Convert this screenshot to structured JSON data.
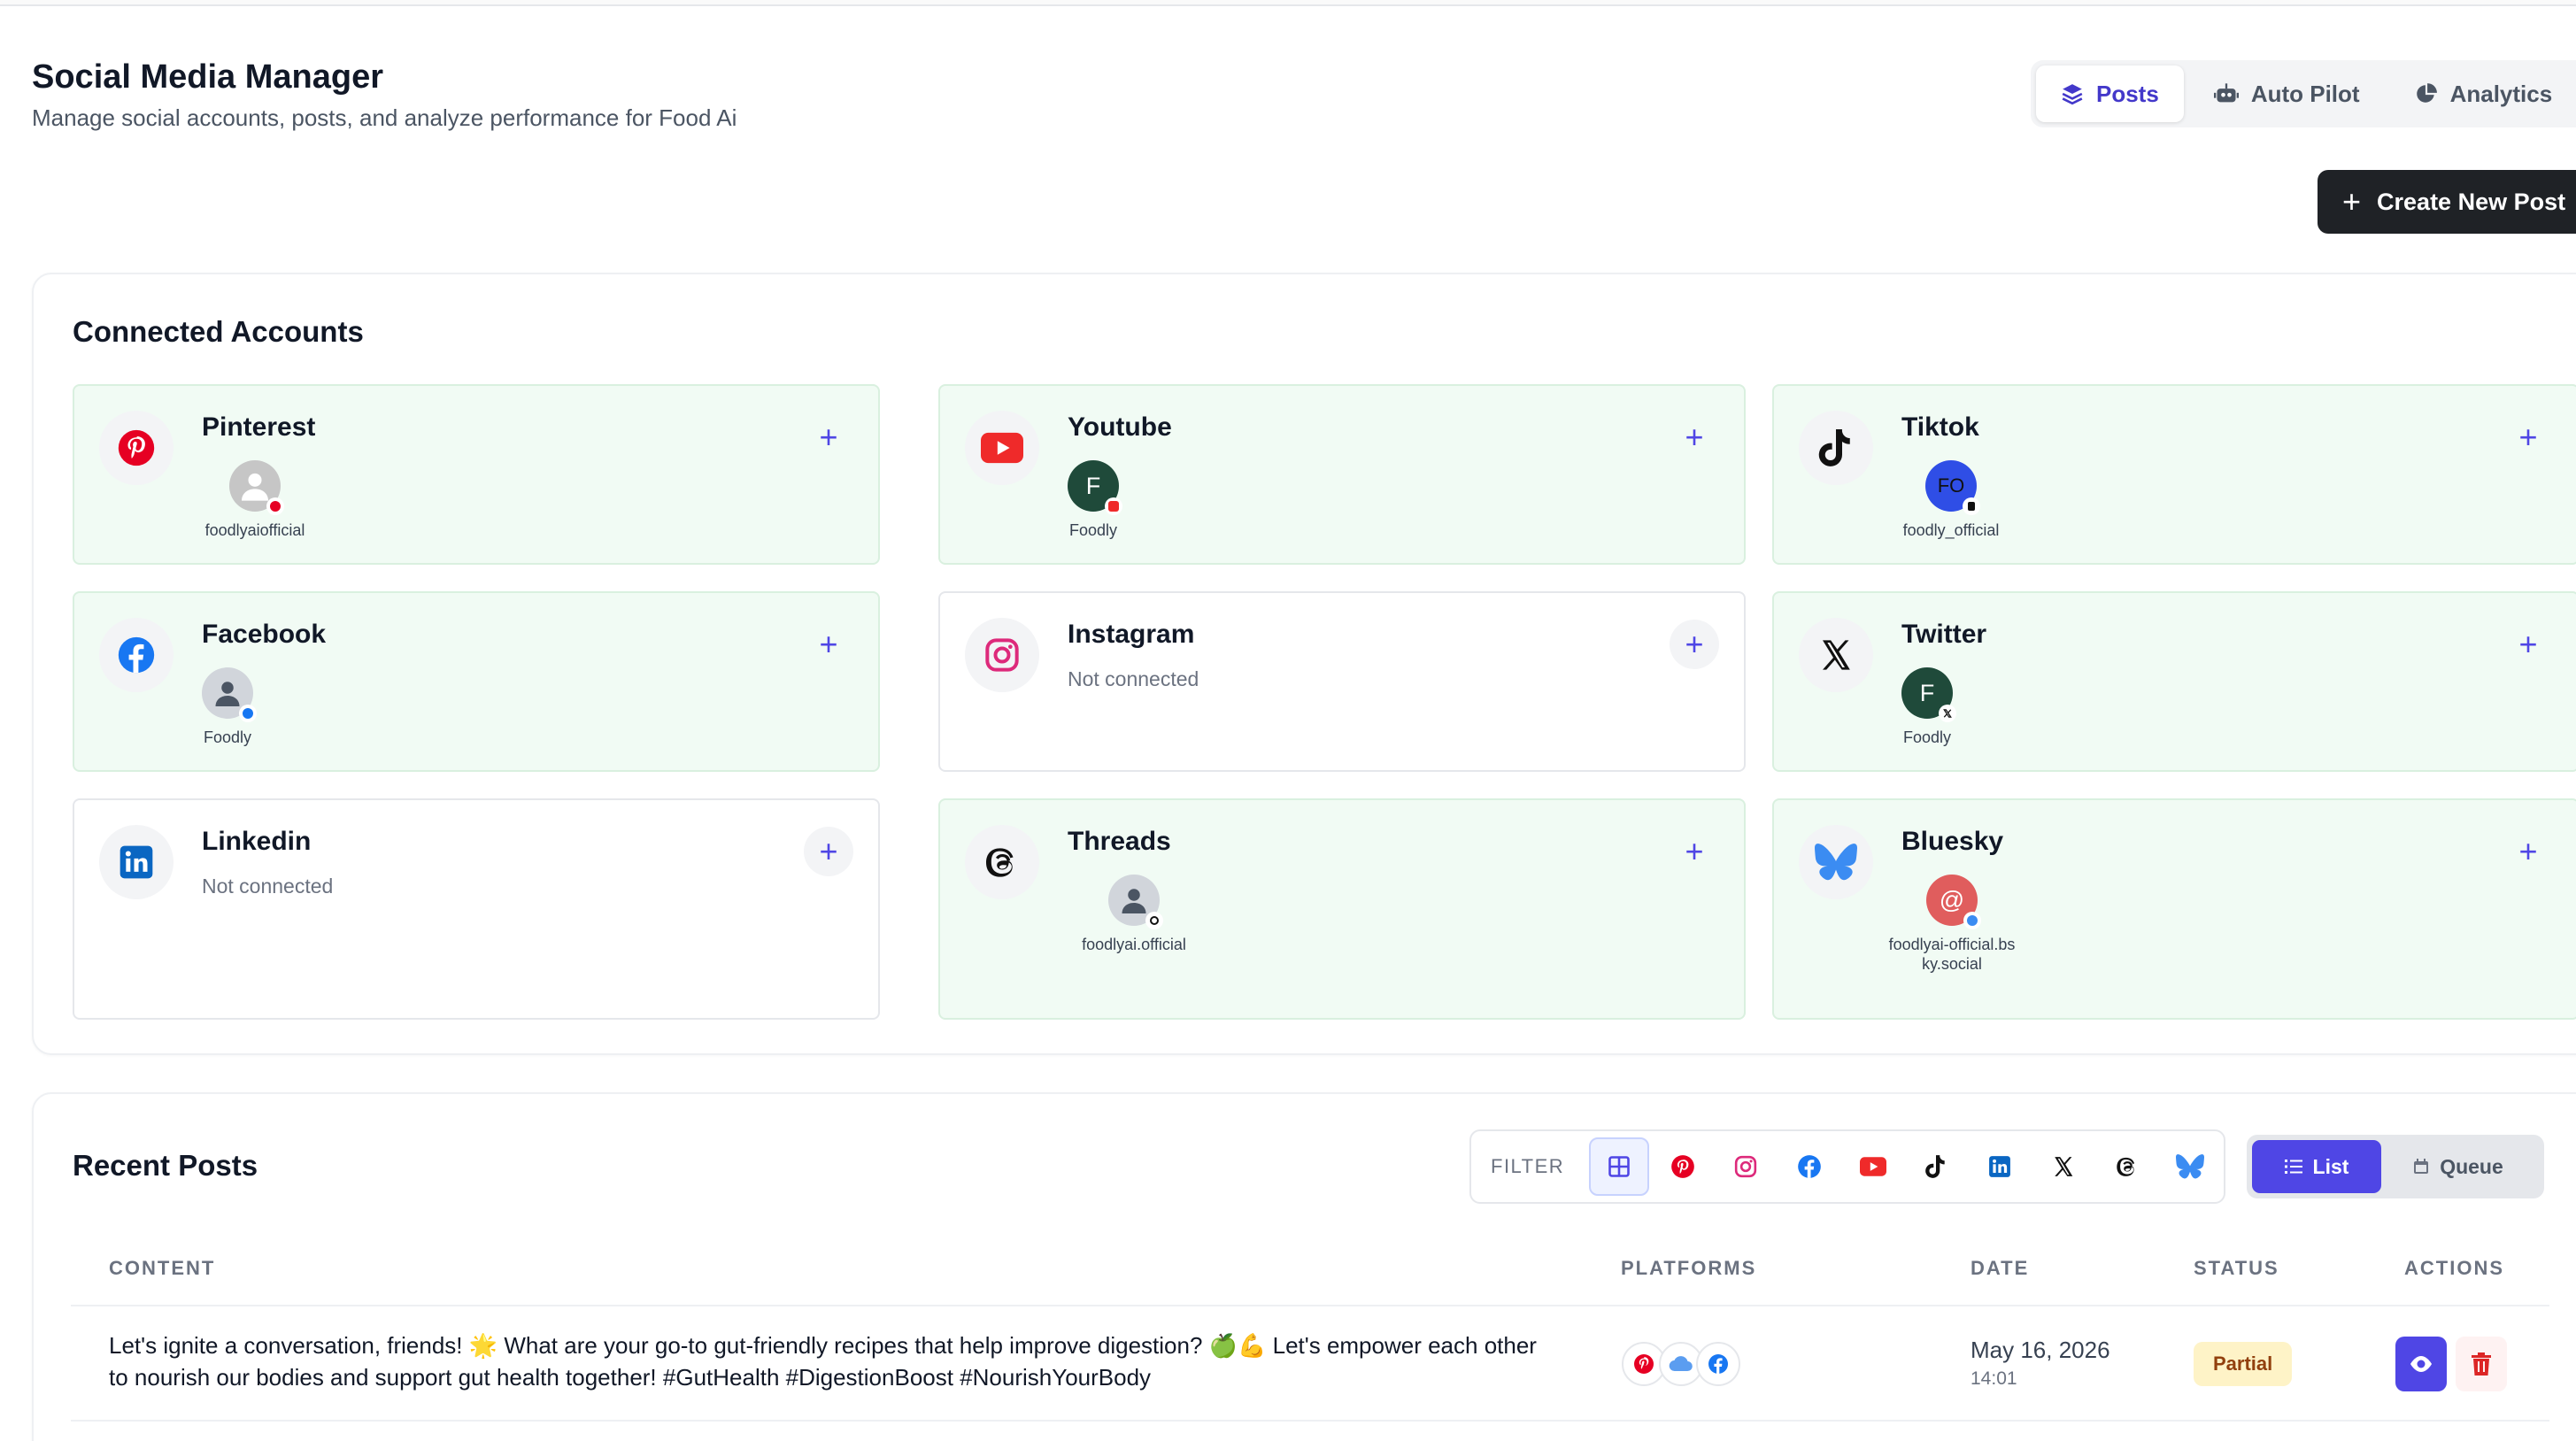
{
  "header": {
    "title": "Social Media Manager",
    "subtitle": "Manage social accounts, posts, and analyze performance for Food Ai"
  },
  "view_tabs": [
    {
      "label": "Posts",
      "icon": "layers-icon",
      "active": true
    },
    {
      "label": "Auto Pilot",
      "icon": "robot-icon",
      "active": false
    },
    {
      "label": "Analytics",
      "icon": "pie-chart-icon",
      "active": false
    }
  ],
  "create_button": {
    "label": "Create New Post",
    "icon": "plus-icon"
  },
  "accounts_section": {
    "title": "Connected Accounts",
    "accounts": [
      {
        "name": "Pinterest",
        "icon": "pinterest-icon",
        "connected": true,
        "handle": "foodlyaiofficial",
        "avatar_text": "",
        "avatar_color": "#bdbdbd"
      },
      {
        "name": "Youtube",
        "icon": "youtube-icon",
        "connected": true,
        "handle": "Foodly",
        "avatar_text": "F",
        "avatar_color": "#1f4a3a"
      },
      {
        "name": "Tiktok",
        "icon": "tiktok-icon",
        "connected": true,
        "handle": "foodly_official",
        "avatar_text": "FO",
        "avatar_color": "#2f4ee6"
      },
      {
        "name": "Facebook",
        "icon": "facebook-icon",
        "connected": true,
        "handle": "Foodly",
        "avatar_text": "",
        "avatar_color": "#d1d5db"
      },
      {
        "name": "Instagram",
        "icon": "instagram-icon",
        "connected": false,
        "status": "Not connected"
      },
      {
        "name": "Twitter",
        "icon": "x-icon",
        "connected": true,
        "handle": "Foodly",
        "avatar_text": "F",
        "avatar_color": "#1f4a3a"
      },
      {
        "name": "Linkedin",
        "icon": "linkedin-icon",
        "connected": false,
        "status": "Not connected"
      },
      {
        "name": "Threads",
        "icon": "threads-icon",
        "connected": true,
        "handle": "foodlyai.official",
        "avatar_text": "",
        "avatar_color": "#d1d5db"
      },
      {
        "name": "Bluesky",
        "icon": "bluesky-icon",
        "connected": true,
        "handle": "foodlyai-official.bsky.social",
        "avatar_text": "@",
        "avatar_color": "#e05d5d"
      }
    ]
  },
  "posts_section": {
    "title": "Recent Posts",
    "filter_label": "FILTER",
    "filters": [
      "all-grid-icon",
      "pinterest-icon",
      "instagram-icon",
      "facebook-icon",
      "youtube-icon",
      "tiktok-icon",
      "linkedin-icon",
      "x-icon",
      "threads-icon",
      "bluesky-icon"
    ],
    "modes": [
      {
        "label": "List",
        "active": true
      },
      {
        "label": "Queue",
        "active": false
      }
    ],
    "columns": {
      "content": "CONTENT",
      "platforms": "PLATFORMS",
      "date": "DATE",
      "status": "STATUS",
      "actions": "ACTIONS"
    },
    "rows": [
      {
        "content": "Let's ignite a conversation, friends! 🌟 What are your go-to gut-friendly recipes that help improve digestion? 🍏💪 Let's empower each other to nourish our bodies and support gut health together! #GutHealth #DigestionBoost #NourishYourBody",
        "platforms": [
          "pinterest-icon",
          "bluesky-cloud-icon",
          "facebook-icon"
        ],
        "date": "May 16, 2026",
        "time": "14:01",
        "status": "Partial"
      }
    ]
  },
  "colors": {
    "accent": "#4f46e5",
    "connected_bg": "#f1fbf4",
    "partial_bg": "#fef3c7",
    "dark_button": "#1f2226"
  }
}
